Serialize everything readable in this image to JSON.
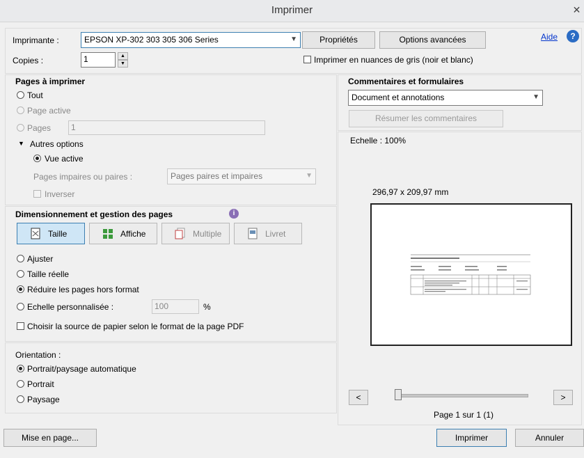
{
  "window": {
    "title": "Imprimer",
    "close_glyph": "✕"
  },
  "printer": {
    "label": "Imprimante :",
    "selected": "EPSON XP-302 303 305 306 Series",
    "properties_button": "Propriétés",
    "advanced_button": "Options avancées",
    "help_link": "Aide",
    "copies_label": "Copies :",
    "copies_value": "1",
    "grayscale_label": "Imprimer en nuances de gris (noir et blanc)"
  },
  "pages": {
    "heading": "Pages à imprimer",
    "all": "Tout",
    "current": "Page active",
    "pages": "Pages",
    "pages_value": "1",
    "more_options": "Autres options",
    "current_view": "Vue active",
    "odd_even_label": "Pages impaires ou paires :",
    "odd_even_value": "Pages paires et impaires",
    "reverse": "Inverser"
  },
  "sizing": {
    "heading": "Dimensionnement et gestion des pages",
    "tabs": {
      "size": "Taille",
      "poster": "Affiche",
      "multiple": "Multiple",
      "booklet": "Livret"
    },
    "fit": "Ajuster",
    "actual": "Taille réelle",
    "shrink": "Réduire les pages hors format",
    "custom": "Echelle personnalisée :",
    "custom_value": "100",
    "percent": "%",
    "paper_source": "Choisir la source de papier selon le format de la page PDF"
  },
  "orientation": {
    "heading": "Orientation :",
    "auto": "Portrait/paysage automatique",
    "portrait": "Portrait",
    "landscape": "Paysage"
  },
  "comments": {
    "heading": "Commentaires et formulaires",
    "selected": "Document et annotations",
    "summarize": "Résumer les commentaires"
  },
  "preview": {
    "scale": "Echelle : 100%",
    "dimensions": "296,97 x 209,97 mm",
    "prev": "<",
    "next": ">",
    "page_info": "Page 1 sur 1 (1)"
  },
  "footer": {
    "page_setup": "Mise en page...",
    "print": "Imprimer",
    "cancel": "Annuler"
  }
}
